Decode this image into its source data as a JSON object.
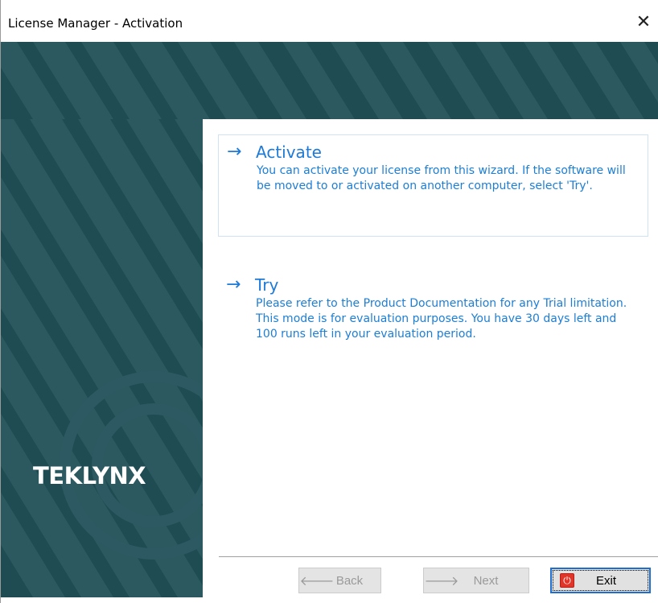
{
  "window": {
    "title": "License Manager - Activation",
    "close_glyph": "✕"
  },
  "brand": {
    "logo_text": "TEKLYNX",
    "panel_color": "#1f4b53"
  },
  "options": {
    "activate": {
      "title": "Activate",
      "description": "You can activate your license from this wizard. If the software will be moved to or activated on another computer, select 'Try'."
    },
    "try": {
      "title": "Try",
      "description": "Please refer to the Product Documentation for any Trial limitation. This mode is for evaluation purposes. You have 30 days left and 100 runs left in your evaluation period."
    },
    "arrow_icon": "→",
    "accent_color": "#1e7ad8"
  },
  "footer": {
    "back_label": "Back",
    "next_label": "Next",
    "exit_label": "Exit",
    "back_icon": "arrow-left-icon",
    "next_icon": "arrow-right-icon",
    "exit_icon": "power-icon"
  }
}
